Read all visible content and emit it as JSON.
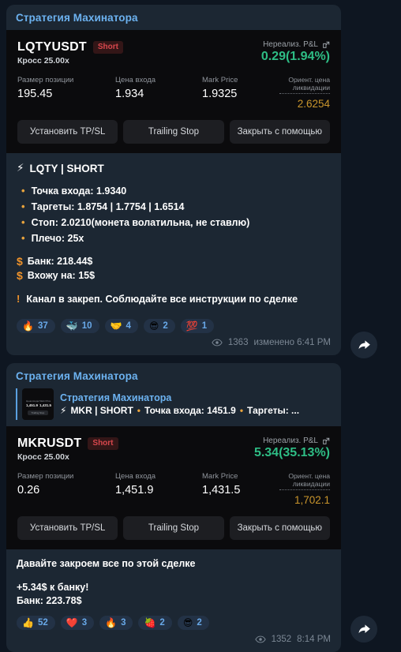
{
  "messages": [
    {
      "channel_title": "Стратегия Махинатора",
      "position_card": {
        "symbol": "LQTYUSDT",
        "side_badge": "Short",
        "margin_mode": "Кросс 25.00x",
        "pnl_label": "Нереализ. P&L",
        "pnl_value": "0.29(1.94%)",
        "pnl_color": "#2ebd85",
        "stats": [
          {
            "label": "Размер позиции",
            "value": "195.45"
          },
          {
            "label": "Цена входа",
            "value": "1.934"
          },
          {
            "label": "Mark Price",
            "value": "1.9325"
          },
          {
            "label": "Ориент. цена ликвидации",
            "value": "2.6254"
          }
        ],
        "buttons": [
          "Установить TP/SL",
          "Trailing Stop",
          "Закрыть с помощью"
        ]
      },
      "signal": {
        "heading": "LQTY | SHORT",
        "heading_icon": "lightning-icon",
        "bullets": [
          "Точка входа: 1.9340",
          "Таргеты: 1.8754 | 1.7754 | 1.6514",
          "Стоп: 2.0210(монета волатильна, не ставлю)",
          "Плечо: 25x"
        ],
        "money": [
          "Банк: 218.44$",
          "Вхожу на: 15$"
        ],
        "warning": "Канал в закреп. Соблюдайте все инструкции по сделке"
      },
      "reactions": [
        {
          "emoji": "🔥",
          "name": "fire-reaction",
          "count": "37"
        },
        {
          "emoji": "🐳",
          "name": "whale-reaction",
          "count": "10"
        },
        {
          "emoji": "🤝",
          "name": "handshake-reaction",
          "count": "4"
        },
        {
          "emoji": "😎",
          "name": "sunglasses-reaction",
          "count": "2"
        },
        {
          "emoji": "💯",
          "name": "hundred-reaction",
          "count": "1"
        }
      ],
      "views": "1363",
      "timestamp": "изменено 6:41 PM"
    },
    {
      "channel_title": "Стратегия Махинатора",
      "quote": {
        "name": "Стратегия Махинатора",
        "text": "MKR | SHORT",
        "extra1": "Точка входа: 1451.9",
        "extra2": "Таргеты: ...",
        "thumb": {
          "label_left": "Цена входа",
          "value_left": "1,451.9",
          "label_right": "Mark Price",
          "value_right": "1,431.5",
          "button": "Trailing Stop"
        }
      },
      "position_card": {
        "symbol": "MKRUSDT",
        "side_badge": "Short",
        "margin_mode": "Кросс 25.00x",
        "pnl_label": "Нереализ. P&L",
        "pnl_value": "5.34(35.13%)",
        "pnl_color": "#2ebd85",
        "stats": [
          {
            "label": "Размер позиции",
            "value": "0.26"
          },
          {
            "label": "Цена входа",
            "value": "1,451.9"
          },
          {
            "label": "Mark Price",
            "value": "1,431.5"
          },
          {
            "label": "Ориент. цена ликвидации",
            "value": "1,702.1"
          }
        ],
        "buttons": [
          "Установить TP/SL",
          "Trailing Stop",
          "Закрыть с помощью"
        ]
      },
      "text_lines": {
        "line1": "Давайте закроем все по этой сделке",
        "line2": "+5.34$ к банку!",
        "line3": "Банк: 223.78$"
      },
      "reactions": [
        {
          "emoji": "👍",
          "name": "thumbsup-reaction",
          "count": "52"
        },
        {
          "emoji": "❤️",
          "name": "heart-reaction",
          "count": "3"
        },
        {
          "emoji": "🔥",
          "name": "fire-reaction",
          "count": "3"
        },
        {
          "emoji": "🍓",
          "name": "strawberry-reaction",
          "count": "2"
        },
        {
          "emoji": "😎",
          "name": "sunglasses-reaction",
          "count": "2"
        }
      ],
      "views": "1352",
      "timestamp": "8:14 PM"
    }
  ],
  "icons": {
    "lightning": "⚡",
    "dollar": "$",
    "bang": "❗",
    "bullet_dot": "•",
    "share": "share-arrow"
  }
}
